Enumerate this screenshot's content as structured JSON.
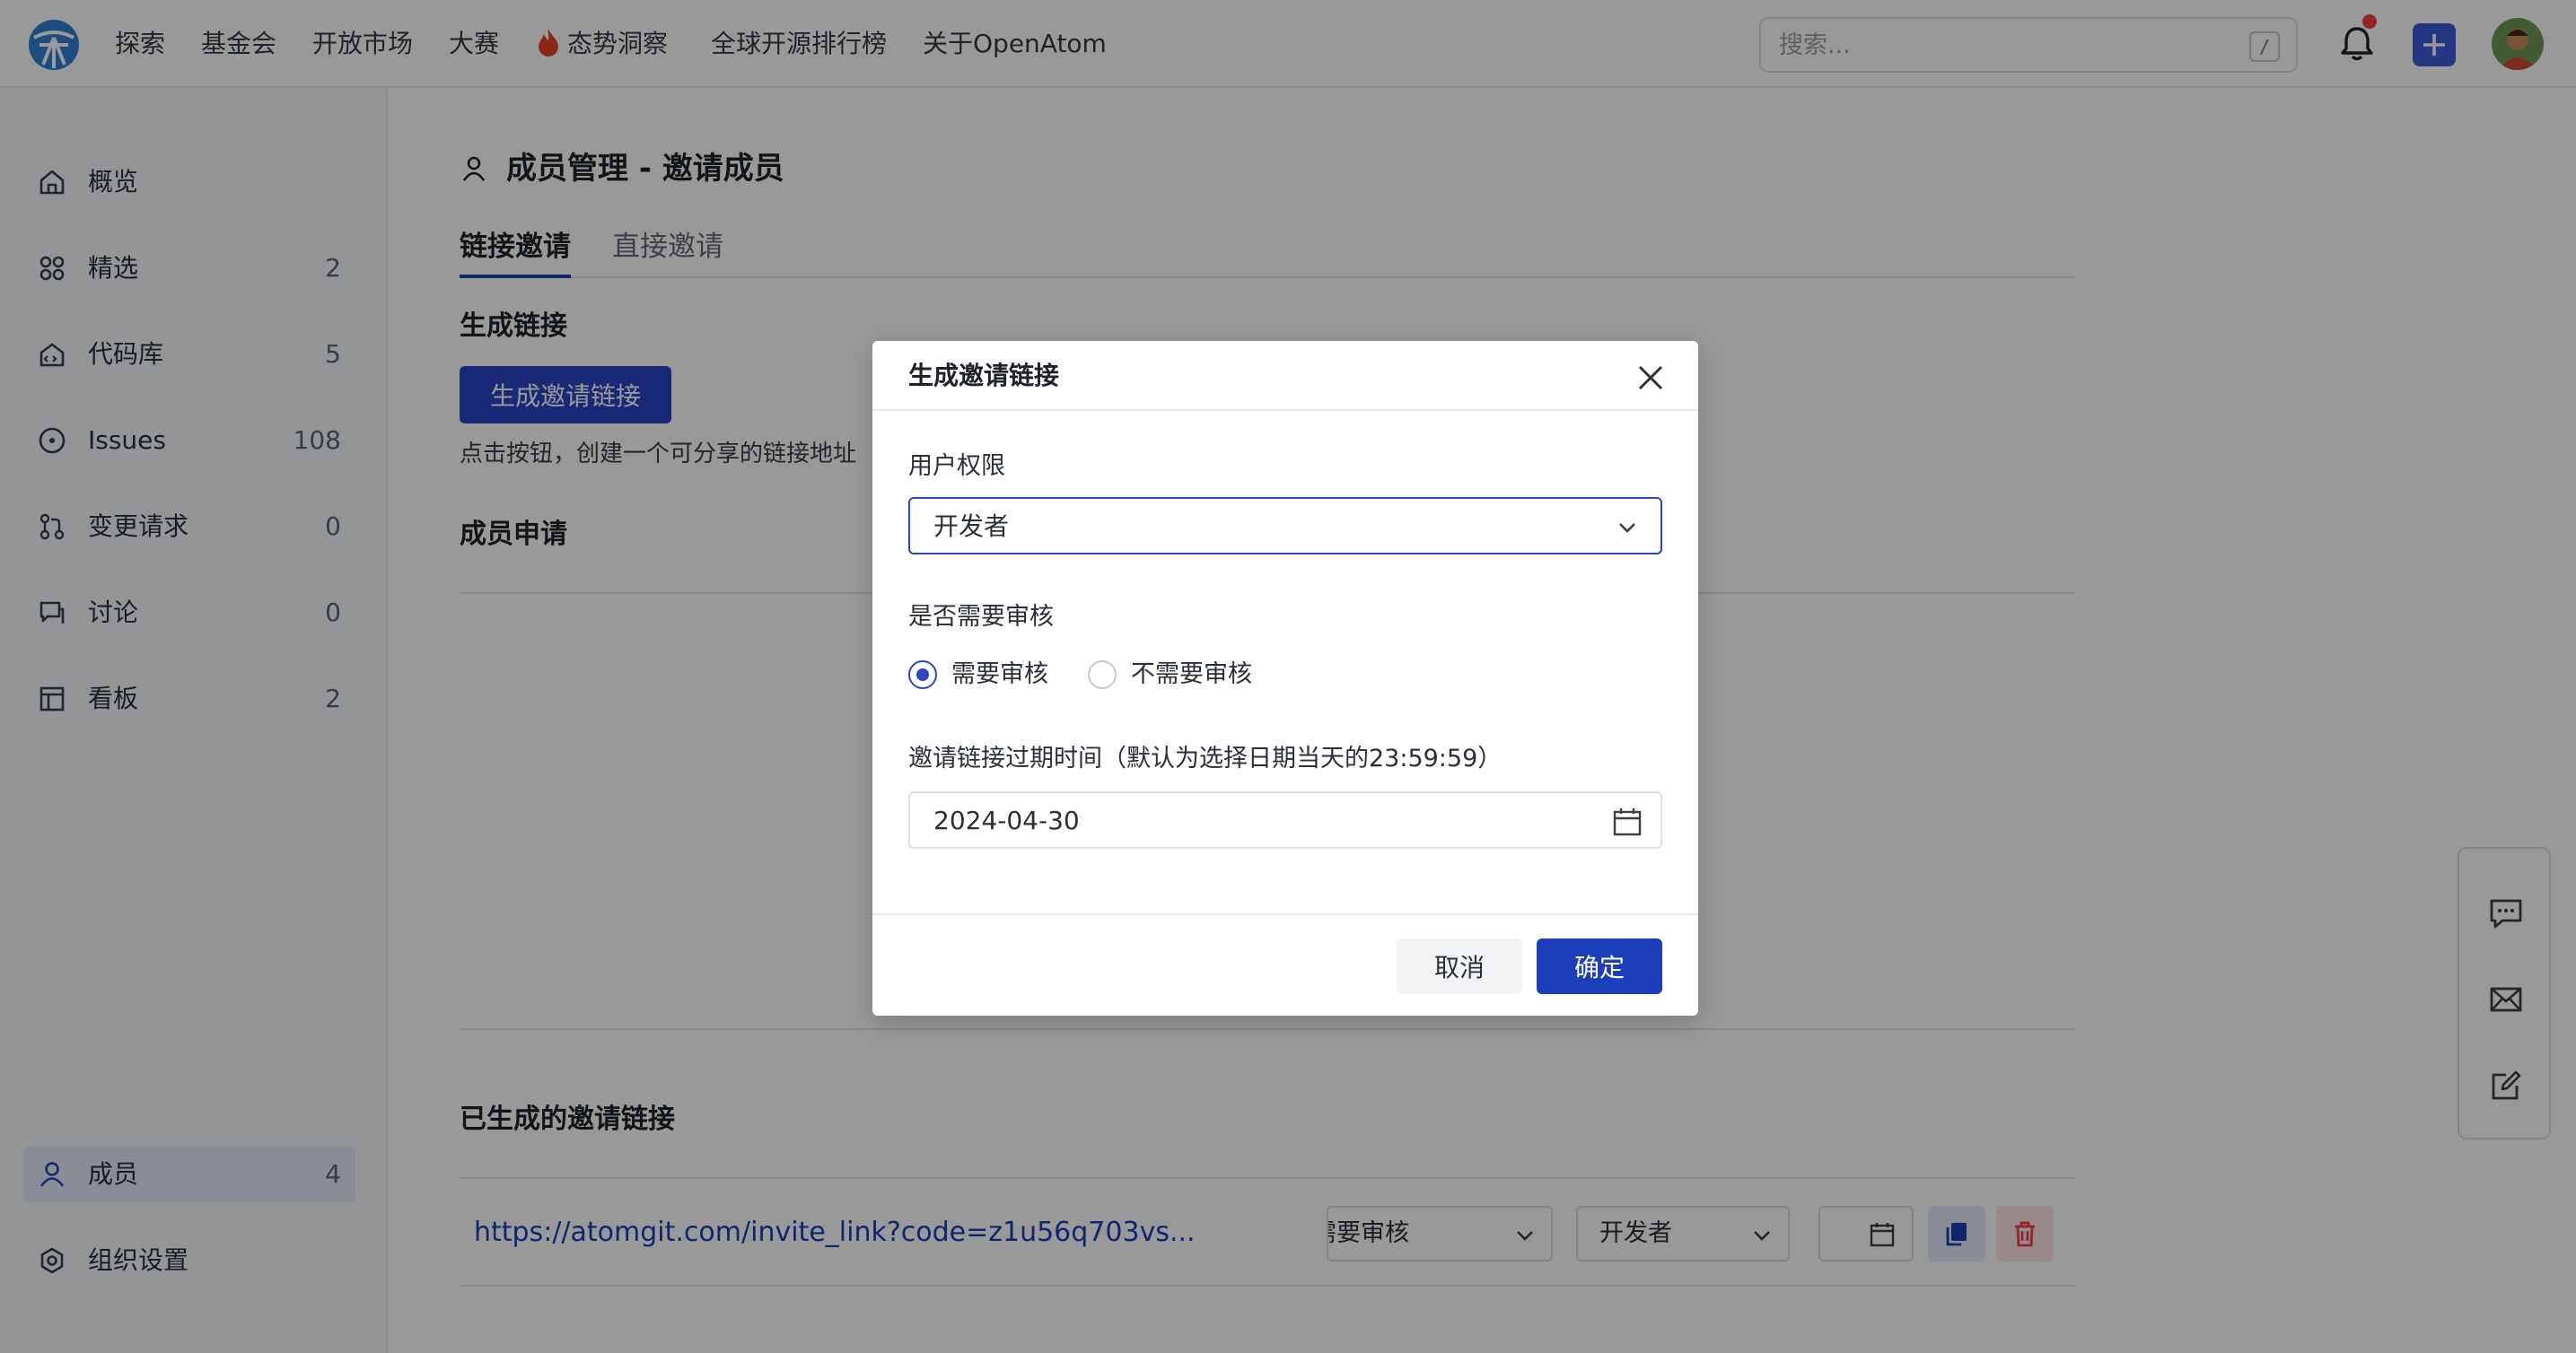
{
  "topnav": {
    "items": [
      "探索",
      "基金会",
      "开放市场",
      "大赛",
      "态势洞察",
      "全球开源排行榜",
      "关于OpenAtom"
    ],
    "search_placeholder": "搜索...",
    "search_shortcut": "/",
    "plus_label": "+"
  },
  "sidebar": {
    "items": [
      {
        "label": "概览",
        "count": "",
        "icon": "home-icon"
      },
      {
        "label": "精选",
        "count": "2",
        "icon": "grid-icon"
      },
      {
        "label": "代码库",
        "count": "5",
        "icon": "repo-icon"
      },
      {
        "label": "Issues",
        "count": "108",
        "icon": "issue-icon"
      },
      {
        "label": "变更请求",
        "count": "0",
        "icon": "pull-request-icon"
      },
      {
        "label": "讨论",
        "count": "0",
        "icon": "discussion-icon"
      },
      {
        "label": "看板",
        "count": "2",
        "icon": "board-icon"
      },
      {
        "label": "成员",
        "count": "4",
        "icon": "user-icon"
      },
      {
        "label": "组织设置",
        "count": "",
        "icon": "settings-icon"
      }
    ],
    "active": "成员"
  },
  "main": {
    "title": "成员管理 - 邀请成员",
    "tabs": [
      {
        "label": "链接邀请",
        "active": true
      },
      {
        "label": "直接邀请",
        "active": false
      }
    ],
    "generate_section": "生成链接",
    "generate_button": "生成邀请链接",
    "generate_hint": "点击按钮，创建一个可分享的链接地址",
    "requests_section": "成员申请",
    "links_section": "已生成的邀请链接",
    "link_row": {
      "url": "https://atomgit.com/invite_link?code=z1u56q703vs...",
      "review_value": "需要审核",
      "role_value": "开发者"
    }
  },
  "modal": {
    "title": "生成邀请链接",
    "permission_label": "用户权限",
    "permission_value": "开发者",
    "review_label": "是否需要审核",
    "review_options": [
      "需要审核",
      "不需要审核"
    ],
    "review_selected": "需要审核",
    "expire_label": "邀请链接过期时间（默认为选择日期当天的23:59:59）",
    "expire_value": "2024-04-30",
    "cancel_label": "取消",
    "ok_label": "确定"
  },
  "colors": {
    "primary": "#2947c6",
    "primary_dark": "#1a3fb8",
    "danger": "#f53f3f"
  }
}
